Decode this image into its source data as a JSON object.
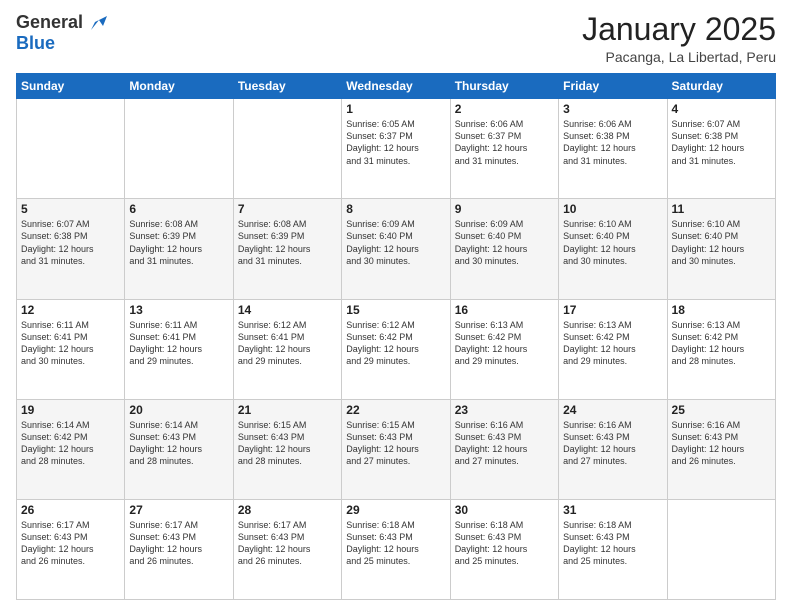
{
  "logo": {
    "general": "General",
    "blue": "Blue"
  },
  "header": {
    "month": "January 2025",
    "location": "Pacanga, La Libertad, Peru"
  },
  "weekdays": [
    "Sunday",
    "Monday",
    "Tuesday",
    "Wednesday",
    "Thursday",
    "Friday",
    "Saturday"
  ],
  "weeks": [
    [
      {
        "day": "",
        "info": ""
      },
      {
        "day": "",
        "info": ""
      },
      {
        "day": "",
        "info": ""
      },
      {
        "day": "1",
        "info": "Sunrise: 6:05 AM\nSunset: 6:37 PM\nDaylight: 12 hours\nand 31 minutes."
      },
      {
        "day": "2",
        "info": "Sunrise: 6:06 AM\nSunset: 6:37 PM\nDaylight: 12 hours\nand 31 minutes."
      },
      {
        "day": "3",
        "info": "Sunrise: 6:06 AM\nSunset: 6:38 PM\nDaylight: 12 hours\nand 31 minutes."
      },
      {
        "day": "4",
        "info": "Sunrise: 6:07 AM\nSunset: 6:38 PM\nDaylight: 12 hours\nand 31 minutes."
      }
    ],
    [
      {
        "day": "5",
        "info": "Sunrise: 6:07 AM\nSunset: 6:38 PM\nDaylight: 12 hours\nand 31 minutes."
      },
      {
        "day": "6",
        "info": "Sunrise: 6:08 AM\nSunset: 6:39 PM\nDaylight: 12 hours\nand 31 minutes."
      },
      {
        "day": "7",
        "info": "Sunrise: 6:08 AM\nSunset: 6:39 PM\nDaylight: 12 hours\nand 31 minutes."
      },
      {
        "day": "8",
        "info": "Sunrise: 6:09 AM\nSunset: 6:40 PM\nDaylight: 12 hours\nand 30 minutes."
      },
      {
        "day": "9",
        "info": "Sunrise: 6:09 AM\nSunset: 6:40 PM\nDaylight: 12 hours\nand 30 minutes."
      },
      {
        "day": "10",
        "info": "Sunrise: 6:10 AM\nSunset: 6:40 PM\nDaylight: 12 hours\nand 30 minutes."
      },
      {
        "day": "11",
        "info": "Sunrise: 6:10 AM\nSunset: 6:40 PM\nDaylight: 12 hours\nand 30 minutes."
      }
    ],
    [
      {
        "day": "12",
        "info": "Sunrise: 6:11 AM\nSunset: 6:41 PM\nDaylight: 12 hours\nand 30 minutes."
      },
      {
        "day": "13",
        "info": "Sunrise: 6:11 AM\nSunset: 6:41 PM\nDaylight: 12 hours\nand 29 minutes."
      },
      {
        "day": "14",
        "info": "Sunrise: 6:12 AM\nSunset: 6:41 PM\nDaylight: 12 hours\nand 29 minutes."
      },
      {
        "day": "15",
        "info": "Sunrise: 6:12 AM\nSunset: 6:42 PM\nDaylight: 12 hours\nand 29 minutes."
      },
      {
        "day": "16",
        "info": "Sunrise: 6:13 AM\nSunset: 6:42 PM\nDaylight: 12 hours\nand 29 minutes."
      },
      {
        "day": "17",
        "info": "Sunrise: 6:13 AM\nSunset: 6:42 PM\nDaylight: 12 hours\nand 29 minutes."
      },
      {
        "day": "18",
        "info": "Sunrise: 6:13 AM\nSunset: 6:42 PM\nDaylight: 12 hours\nand 28 minutes."
      }
    ],
    [
      {
        "day": "19",
        "info": "Sunrise: 6:14 AM\nSunset: 6:42 PM\nDaylight: 12 hours\nand 28 minutes."
      },
      {
        "day": "20",
        "info": "Sunrise: 6:14 AM\nSunset: 6:43 PM\nDaylight: 12 hours\nand 28 minutes."
      },
      {
        "day": "21",
        "info": "Sunrise: 6:15 AM\nSunset: 6:43 PM\nDaylight: 12 hours\nand 28 minutes."
      },
      {
        "day": "22",
        "info": "Sunrise: 6:15 AM\nSunset: 6:43 PM\nDaylight: 12 hours\nand 27 minutes."
      },
      {
        "day": "23",
        "info": "Sunrise: 6:16 AM\nSunset: 6:43 PM\nDaylight: 12 hours\nand 27 minutes."
      },
      {
        "day": "24",
        "info": "Sunrise: 6:16 AM\nSunset: 6:43 PM\nDaylight: 12 hours\nand 27 minutes."
      },
      {
        "day": "25",
        "info": "Sunrise: 6:16 AM\nSunset: 6:43 PM\nDaylight: 12 hours\nand 26 minutes."
      }
    ],
    [
      {
        "day": "26",
        "info": "Sunrise: 6:17 AM\nSunset: 6:43 PM\nDaylight: 12 hours\nand 26 minutes."
      },
      {
        "day": "27",
        "info": "Sunrise: 6:17 AM\nSunset: 6:43 PM\nDaylight: 12 hours\nand 26 minutes."
      },
      {
        "day": "28",
        "info": "Sunrise: 6:17 AM\nSunset: 6:43 PM\nDaylight: 12 hours\nand 26 minutes."
      },
      {
        "day": "29",
        "info": "Sunrise: 6:18 AM\nSunset: 6:43 PM\nDaylight: 12 hours\nand 25 minutes."
      },
      {
        "day": "30",
        "info": "Sunrise: 6:18 AM\nSunset: 6:43 PM\nDaylight: 12 hours\nand 25 minutes."
      },
      {
        "day": "31",
        "info": "Sunrise: 6:18 AM\nSunset: 6:43 PM\nDaylight: 12 hours\nand 25 minutes."
      },
      {
        "day": "",
        "info": ""
      }
    ]
  ]
}
